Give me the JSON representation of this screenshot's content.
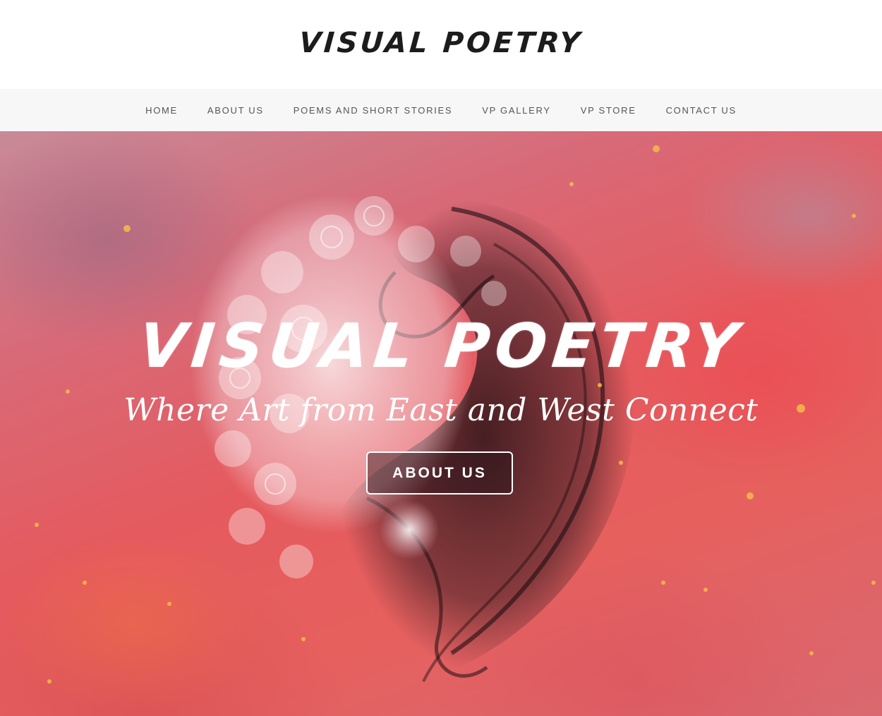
{
  "header": {
    "logo_text": "VISUAL POETRY"
  },
  "nav": {
    "items": [
      {
        "label": "HOME"
      },
      {
        "label": "ABOUT US"
      },
      {
        "label": "POEMS AND SHORT STORIES"
      },
      {
        "label": "VP GALLERY"
      },
      {
        "label": "VP STORE"
      },
      {
        "label": "CONTACT US"
      }
    ]
  },
  "hero": {
    "title": "VISUAL POETRY",
    "subtitle": "Where Art from East and West Connect",
    "button_label": "ABOUT US",
    "image": "yin-yang-flowers-and-smoke-artwork"
  },
  "colors": {
    "nav_background": "#f7f7f7",
    "nav_text": "#555555",
    "logo_text": "#1c1c1c",
    "hero_text": "#ffffff",
    "hero_base": "#e55a5e"
  }
}
